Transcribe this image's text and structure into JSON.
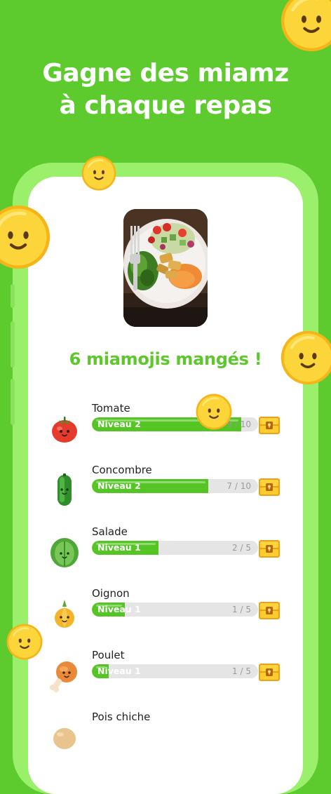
{
  "headline": {
    "line1": "Gagne des miamz",
    "line2": "à chaque repas"
  },
  "summary": {
    "title": "6 miamojis mangés !"
  },
  "colors": {
    "background": "#5DCB2E",
    "accent": "#5DC72B",
    "bar_fill": "#55C525",
    "coin": "#F7C71E"
  },
  "foods": [
    {
      "name": "Tomate",
      "level": "Niveau 2",
      "count": "9 / 10",
      "progress": 0.9,
      "icon": "tomato-icon"
    },
    {
      "name": "Concombre",
      "level": "Niveau 2",
      "count": "7 / 10",
      "progress": 0.7,
      "icon": "cucumber-icon"
    },
    {
      "name": "Salade",
      "level": "Niveau 1",
      "count": "2 / 5",
      "progress": 0.4,
      "icon": "lettuce-icon"
    },
    {
      "name": "Oignon",
      "level": "Niveau 1",
      "count": "1 / 5",
      "progress": 0.2,
      "icon": "onion-icon"
    },
    {
      "name": "Poulet",
      "level": "Niveau 1",
      "count": "1 / 5",
      "progress": 0.1,
      "icon": "chicken-leg-icon"
    },
    {
      "name": "Pois chiche",
      "level": "",
      "count": "",
      "progress": 0,
      "icon": "chickpea-icon"
    }
  ]
}
